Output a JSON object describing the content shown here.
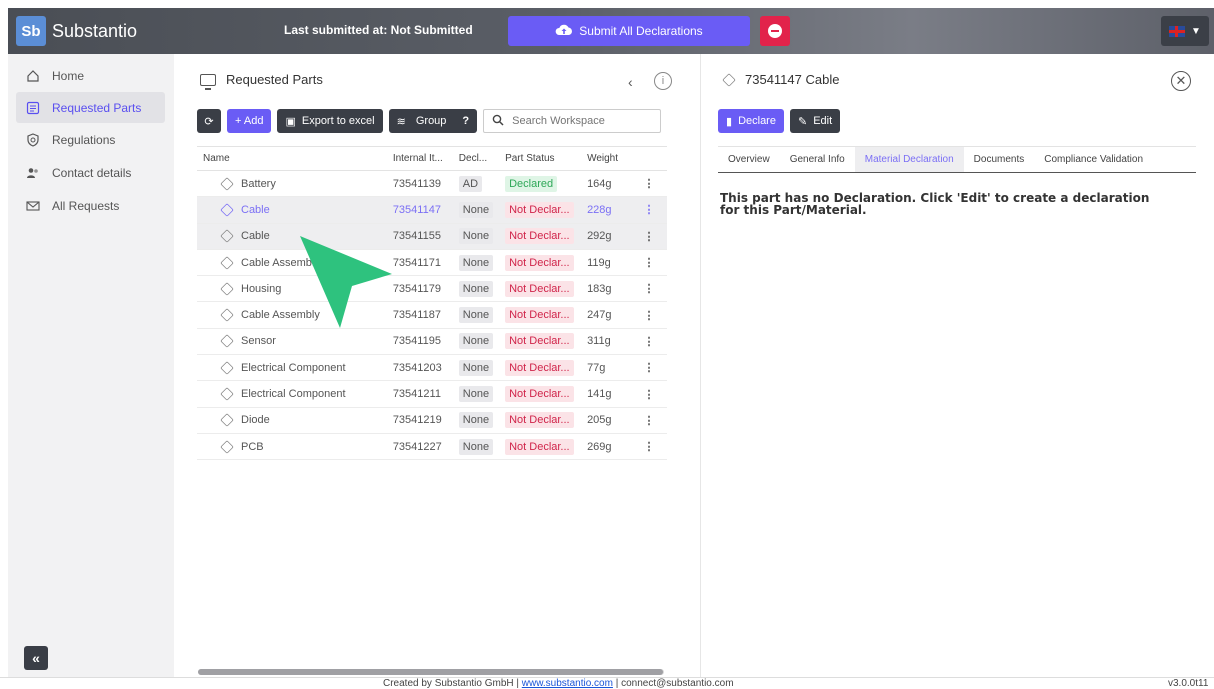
{
  "header": {
    "logo_text": "Sb",
    "app_title": "Substantio",
    "last_submitted": "Last submitted at: Not Submitted",
    "submit_label": "Submit All Declarations",
    "language": "English (UK)"
  },
  "sidebar": {
    "items": [
      {
        "label": "Home",
        "icon": "home-icon",
        "active": false
      },
      {
        "label": "Requested Parts",
        "icon": "list-icon",
        "active": true
      },
      {
        "label": "Regulations",
        "icon": "shield-icon",
        "active": false
      },
      {
        "label": "Contact details",
        "icon": "contacts-icon",
        "active": false
      },
      {
        "label": "All Requests",
        "icon": "mail-icon",
        "active": false
      }
    ],
    "collapse_label": "«"
  },
  "parts_panel": {
    "title": "Requested Parts",
    "toolbar": {
      "add_label": "+ Add",
      "export_label": "Export to excel",
      "group_label": "Group",
      "help_label": "?",
      "search_placeholder": "Search Workspace"
    },
    "columns": [
      "Name",
      "Internal It...",
      "Decl...",
      "Part Status",
      "Weight"
    ],
    "rows": [
      {
        "name": "Battery",
        "internal": "73541139",
        "decl": "AD",
        "status": "Declared",
        "weight": "164g"
      },
      {
        "name": "Cable",
        "internal": "73541147",
        "decl": "None",
        "status": "Not Declar...",
        "weight": "228g"
      },
      {
        "name": "Cable",
        "internal": "73541155",
        "decl": "None",
        "status": "Not Declar...",
        "weight": "292g"
      },
      {
        "name": "Cable Assemb...",
        "internal": "73541171",
        "decl": "None",
        "status": "Not Declar...",
        "weight": "119g"
      },
      {
        "name": "Housing",
        "internal": "73541179",
        "decl": "None",
        "status": "Not Declar...",
        "weight": "183g"
      },
      {
        "name": "Cable Assembly",
        "internal": "73541187",
        "decl": "None",
        "status": "Not Declar...",
        "weight": "247g"
      },
      {
        "name": "Sensor",
        "internal": "73541195",
        "decl": "None",
        "status": "Not Declar...",
        "weight": "311g"
      },
      {
        "name": "Electrical Component",
        "internal": "73541203",
        "decl": "None",
        "status": "Not Declar...",
        "weight": "77g"
      },
      {
        "name": "Electrical Component",
        "internal": "73541211",
        "decl": "None",
        "status": "Not Declar...",
        "weight": "141g"
      },
      {
        "name": "Diode",
        "internal": "73541219",
        "decl": "None",
        "status": "Not Declar...",
        "weight": "205g"
      },
      {
        "name": "PCB",
        "internal": "73541227",
        "decl": "None",
        "status": "Not Declar...",
        "weight": "269g"
      }
    ]
  },
  "detail_panel": {
    "title": "73541147 Cable",
    "declare_label": "Declare",
    "edit_label": "Edit",
    "tabs": [
      "Overview",
      "General Info",
      "Material Declaration",
      "Documents",
      "Compliance Validation"
    ],
    "active_tab": "Material Declaration",
    "message_pre": "This part has no Declaration. Click '",
    "message_bold": "Edit",
    "message_post": "' to create a declaration for this Part/Material."
  },
  "footer": {
    "created_by": "Created by Substantio GmbH | ",
    "website": "www.substantio.com",
    "separator": " | ",
    "email": "connect@substantio.com",
    "version": "v3.0.0t11"
  },
  "colors": {
    "accent": "#6a5cf5",
    "danger": "#e2234b",
    "declared_green": "#2ea858",
    "not_declared_red": "#d0244a",
    "pointer": "#2ec27e"
  }
}
